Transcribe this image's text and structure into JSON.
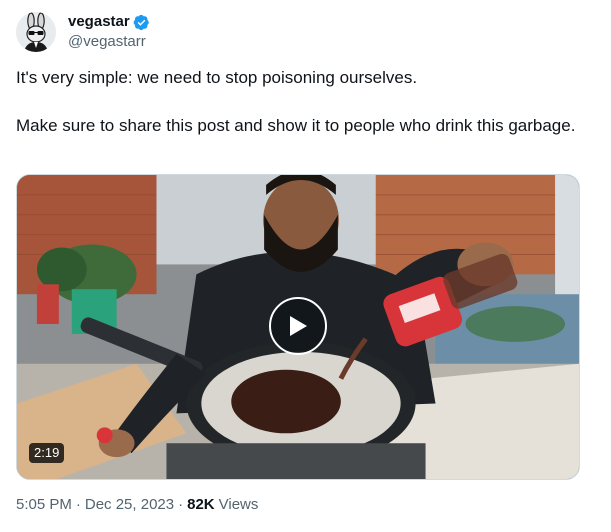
{
  "author": {
    "display_name": "vegastar",
    "handle": "@vegastarr",
    "verified": true,
    "verified_color": "#1d9bf0"
  },
  "tweet": {
    "paragraphs": [
      "It's very simple: we need to stop poisoning ourselves.",
      "Make sure to share this post and show it to people who drink this garbage."
    ]
  },
  "media": {
    "type": "video",
    "duration": "2:19",
    "play_icon": "play-icon"
  },
  "meta": {
    "time": "5:05 PM",
    "separator": "·",
    "date": "Dec 25, 2023",
    "views_count": "82K",
    "views_label": "Views"
  },
  "colors": {
    "text_primary": "#0f1419",
    "text_secondary": "#536471",
    "border": "#cfd9de"
  }
}
